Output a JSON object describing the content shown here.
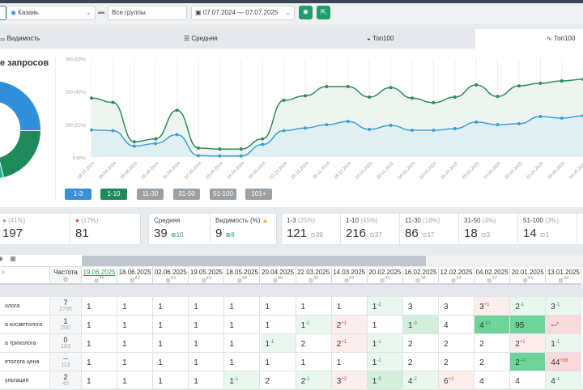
{
  "toolbar": {
    "city": "Казань",
    "group": "Все группы",
    "date_range": "07.07.2024 — 07.07.2025"
  },
  "tabs": [
    {
      "label": "Видимость"
    },
    {
      "label": "Средняя"
    },
    {
      "label": "Топ100"
    },
    {
      "label": "Топ100"
    }
  ],
  "donut": {
    "title": "е запросов"
  },
  "chart_data": {
    "type": "line",
    "y_ticks": [
      "0 (0%)",
      "100 (21%)",
      "200 (41%)",
      "300 (62%)"
    ],
    "ylim": [
      0,
      300
    ],
    "x": [
      "18.07.2024",
      "06.08.2024",
      "19.08.2024",
      "20.08.2024",
      "31.08.2024",
      "12.09.2024",
      "13.09.2024",
      "14.09.2024",
      "29.09.2024",
      "02.10.2024",
      "20.10.2024",
      "20.11.2024",
      "18.12.2024",
      "13.01.2025",
      "20.01.2025",
      "04.02.2025",
      "12.02.2025",
      "16.02.2025",
      "20.02.2025",
      "14.03.2025",
      "22.03.2025",
      "20.04.2025",
      "18.05.2025",
      "19.05.2025"
    ],
    "series": [
      {
        "name": "1-10",
        "color": "#2e8b5f",
        "values": [
          179,
          166,
          46,
          55,
          142,
          27,
          24,
          24,
          55,
          172,
          186,
          214,
          214,
          182,
          211,
          179,
          165,
          182,
          219,
          184,
          216,
          224,
          231,
          236
        ]
      },
      {
        "name": "1-3",
        "color": "#3f9fd6",
        "values": [
          82,
          80,
          33,
          41,
          68,
          4,
          3,
          3,
          38,
          80,
          88,
          98,
          108,
          84,
          96,
          81,
          81,
          86,
          106,
          98,
          101,
          123,
          118,
          125
        ]
      }
    ]
  },
  "range_buttons": [
    {
      "label": "1-3",
      "color": "#3a8fd9"
    },
    {
      "label": "1-10",
      "color": "#1f8a5c"
    },
    {
      "label": "11-30",
      "color": "#9aa0a4"
    },
    {
      "label": "31-50",
      "color": "#9aa0a4"
    },
    {
      "label": "51-100",
      "color": "#9aa0a4"
    },
    {
      "label": "101+",
      "color": "#9aa0a4"
    }
  ],
  "stats1": [
    {
      "pct": "(41%)",
      "value": "197"
    },
    {
      "pct": "(17%)",
      "value": "81"
    }
  ],
  "stats2": [
    {
      "label": "Средняя",
      "value": "39",
      "delta": "10"
    },
    {
      "label": "Видимость (%)",
      "value": "9",
      "delta": "8"
    }
  ],
  "stats3": [
    {
      "label": "1-3",
      "pct": "(25%)",
      "value": "121",
      "delta": "39"
    },
    {
      "label": "1-10",
      "pct": "(45%)",
      "value": "216",
      "delta": "37"
    },
    {
      "label": "11-30",
      "pct": "(18%)",
      "value": "86",
      "delta": "17"
    },
    {
      "label": "31-50",
      "pct": "(4%)",
      "value": "18",
      "delta": "3"
    },
    {
      "label": "51-100",
      "pct": "(3%)",
      "value": "14",
      "delta": "1"
    }
  ],
  "table": {
    "freq_header": "Частота",
    "dates": [
      {
        "d": "19.06.2025",
        "n": "45"
      },
      {
        "d": "18.06.2025",
        "n": "42"
      },
      {
        "d": "02.06.2025",
        "n": "43"
      },
      {
        "d": "19.05.2025",
        "n": "49"
      },
      {
        "d": "18.05.2025",
        "n": "48"
      },
      {
        "d": "20.04.2025",
        "n": "46"
      },
      {
        "d": "22.03.2025",
        "n": "45"
      },
      {
        "d": "14.03.2025",
        "n": "39"
      },
      {
        "d": "20.02.2025",
        "n": "45"
      },
      {
        "d": "16.02.2025",
        "n": "38"
      },
      {
        "d": "12.02.2025",
        "n": "34"
      },
      {
        "d": "04.02.2025",
        "n": "37"
      },
      {
        "d": "20.01.2025",
        "n": "44"
      },
      {
        "d": "13.01.2025",
        "n": "38"
      }
    ],
    "rows": [
      {
        "label": "олога",
        "f1": "7",
        "f2": "2795",
        "cells": [
          [
            "1"
          ],
          [
            "1"
          ],
          [
            "1"
          ],
          [
            "1"
          ],
          [
            "1"
          ],
          [
            "1"
          ],
          [
            "1"
          ],
          [
            "1"
          ],
          [
            "1",
            "-2",
            "g1"
          ],
          [
            "3"
          ],
          [
            "3"
          ],
          [
            "3",
            "+1",
            "p1"
          ],
          [
            "2",
            "-1",
            "g1"
          ],
          [
            "3",
            "-1",
            "g1"
          ]
        ]
      },
      {
        "label": "а косметолога",
        "f1": "1",
        "f2": "200",
        "cells": [
          [
            "1"
          ],
          [
            "1"
          ],
          [
            "1"
          ],
          [
            "1"
          ],
          [
            "1"
          ],
          [
            "1"
          ],
          [
            "1",
            "-1",
            "g1"
          ],
          [
            "2",
            "+1",
            "p1"
          ],
          [
            "1"
          ],
          [
            "1",
            "-3",
            "g2"
          ],
          [
            "4"
          ],
          [
            "4",
            "-91",
            "g3"
          ],
          [
            "95",
            "-",
            "g3"
          ],
          [
            "--",
            "x",
            "p2"
          ]
        ]
      },
      {
        "label": "а трихолога",
        "f1": "0",
        "f2": "183",
        "cells": [
          [
            "1"
          ],
          [
            "1"
          ],
          [
            "1"
          ],
          [
            "1"
          ],
          [
            "1"
          ],
          [
            "1",
            "-1",
            "g1"
          ],
          [
            "2"
          ],
          [
            "2",
            "+1",
            "p1"
          ],
          [
            "1",
            "-1",
            "g1"
          ],
          [
            "2"
          ],
          [
            "2"
          ],
          [
            "2"
          ],
          [
            "2",
            "+1",
            "p1"
          ],
          [
            "1",
            "-1",
            "g1"
          ]
        ]
      },
      {
        "label": "етолога цена",
        "f1": "--",
        "f2": "113",
        "cells": [
          [
            "1"
          ],
          [
            "1"
          ],
          [
            "1"
          ],
          [
            "1"
          ],
          [
            "1"
          ],
          [
            "1"
          ],
          [
            "1"
          ],
          [
            "1"
          ],
          [
            "1",
            "-1",
            "g1"
          ],
          [
            "2"
          ],
          [
            "2"
          ],
          [
            "2"
          ],
          [
            "2",
            "-42",
            "g3"
          ],
          [
            "44",
            "+36",
            "p2"
          ]
        ]
      },
      {
        "label": "ультация",
        "f1": "2",
        "f2": "40",
        "cells": [
          [
            "1"
          ],
          [
            "1"
          ],
          [
            "1"
          ],
          [
            "1"
          ],
          [
            "1",
            "-1",
            "g1"
          ],
          [
            "2"
          ],
          [
            "2",
            "-1",
            "g1"
          ],
          [
            "3",
            "+2",
            "p1"
          ],
          [
            "1",
            "-3",
            "g2"
          ],
          [
            "4",
            "-2",
            "g1"
          ],
          [
            "6",
            "+2",
            "p1"
          ],
          [
            "4"
          ],
          [
            "4"
          ],
          [
            "4",
            "-1",
            "g1"
          ]
        ]
      }
    ]
  }
}
